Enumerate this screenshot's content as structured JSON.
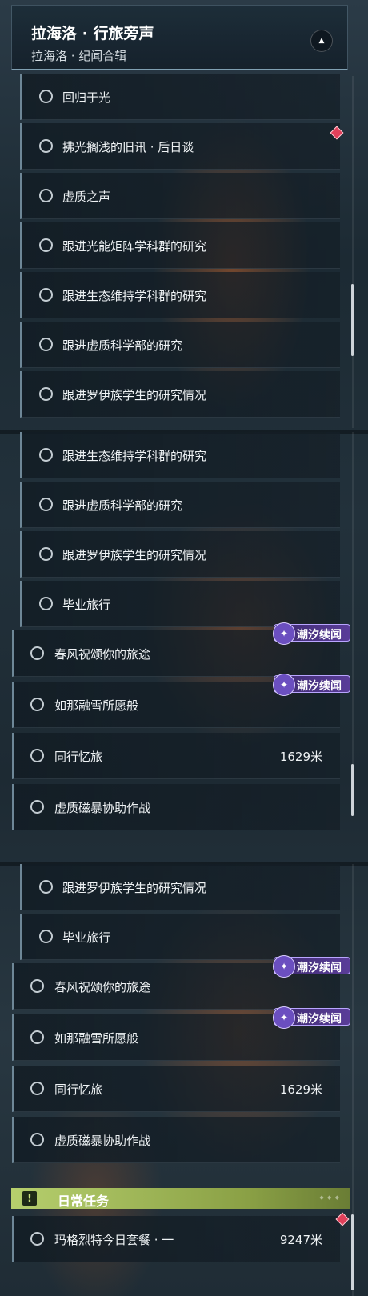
{
  "header": {
    "title": "拉海洛 · 行旅旁声",
    "subtitle": "拉海洛 · 纪闻合辑"
  },
  "icons": {
    "collapse": "chevron-up-icon",
    "badge": "tide-star-icon",
    "section": "exclamation-icon",
    "marker": "red-diamond-icon"
  },
  "panel1": {
    "rows": [
      {
        "label": "回归于光"
      },
      {
        "label": "拂光搁浅的旧讯 · 后日谈"
      },
      {
        "label": "虚质之声"
      },
      {
        "label": "跟进光能矩阵学科群的研究"
      },
      {
        "label": "跟进生态维持学科群的研究"
      },
      {
        "label": "跟进虚质科学部的研究"
      },
      {
        "label": "跟进罗伊族学生的研究情况"
      }
    ]
  },
  "panel2": {
    "rows": [
      {
        "label": "跟进生态维持学科群的研究"
      },
      {
        "label": "跟进虚质科学部的研究"
      },
      {
        "label": "跟进罗伊族学生的研究情况"
      },
      {
        "label": "毕业旅行"
      },
      {
        "label": "春风祝颂你的旅途"
      },
      {
        "label": "如那融雪所愿般"
      },
      {
        "label": "同行忆旅",
        "distance": "1629米"
      },
      {
        "label": "虚质磁暴协助作战"
      }
    ],
    "badges": [
      "潮汐续闻",
      "潮汐续闻"
    ]
  },
  "panel3": {
    "rows": [
      {
        "label": "跟进罗伊族学生的研究情况"
      },
      {
        "label": "毕业旅行"
      },
      {
        "label": "春风祝颂你的旅途"
      },
      {
        "label": "如那融雪所愿般"
      },
      {
        "label": "同行忆旅",
        "distance": "1629米"
      },
      {
        "label": "虚质磁暴协助作战"
      }
    ],
    "badges": [
      "潮汐续闻",
      "潮汐续闻"
    ],
    "section": {
      "title": "日常任务",
      "icon_text": "!"
    },
    "daily_rows": [
      {
        "label": "玛格烈特今日套餐 · 一",
        "distance": "9247米"
      }
    ]
  },
  "colors": {
    "accent": "#6e8797",
    "badge": "#5a3d99",
    "section": "#b6cf6d",
    "marker": "#e0405a"
  }
}
